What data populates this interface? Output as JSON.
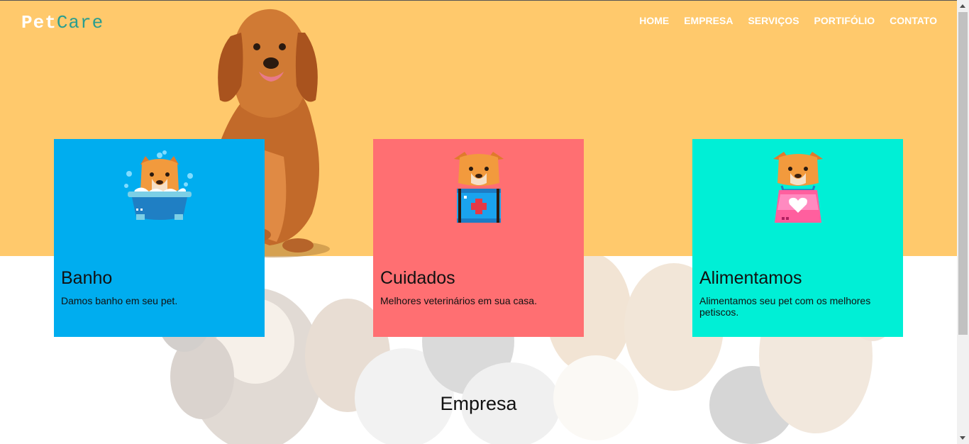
{
  "brand": {
    "part1": "Pet",
    "part2": "Care"
  },
  "nav": [
    {
      "label": "HOME"
    },
    {
      "label": "EMPRESA"
    },
    {
      "label": "SERVIÇOS"
    },
    {
      "label": "PORTIFÓLIO"
    },
    {
      "label": "CONTATO"
    }
  ],
  "cards": [
    {
      "title": "Banho",
      "text": "Damos banho em seu pet.",
      "icon": "dog-bath-icon",
      "color": "#00adef"
    },
    {
      "title": "Cuidados",
      "text": "Melhores veterinários em sua casa.",
      "icon": "dog-first-aid-icon",
      "color": "#ff6f72"
    },
    {
      "title": "Alimentamos",
      "text": "Alimentamos seu pet com os melhores petiscos.",
      "icon": "dog-food-bag-icon",
      "color": "#00efd6"
    }
  ],
  "section": {
    "title": "Empresa"
  },
  "colors": {
    "hero": "#ffc96c",
    "brand_accent": "#2a9d8f"
  }
}
